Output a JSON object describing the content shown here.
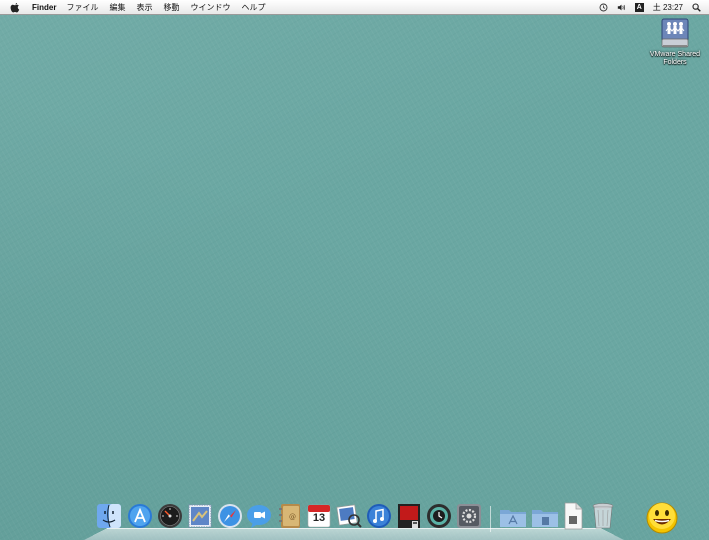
{
  "menubar": {
    "app_name": "Finder",
    "items": [
      "ファイル",
      "編集",
      "表示",
      "移動",
      "ウインドウ",
      "ヘルプ"
    ],
    "clock": "土 23:27",
    "input_badge": "A"
  },
  "desktop": {
    "icons": [
      {
        "label_line1": "VMware Shared",
        "label_line2": "Folders",
        "icon": "shared-folders-drive-icon"
      }
    ]
  },
  "dock": {
    "items": [
      {
        "name": "finder",
        "icon": "finder-icon"
      },
      {
        "name": "app-store",
        "icon": "app-store-icon"
      },
      {
        "name": "dashboard",
        "icon": "dashboard-icon"
      },
      {
        "name": "mail",
        "icon": "mail-stamp-icon"
      },
      {
        "name": "safari",
        "icon": "safari-compass-icon"
      },
      {
        "name": "ichat",
        "icon": "chat-bubble-icon"
      },
      {
        "name": "address-book",
        "icon": "address-book-icon"
      },
      {
        "name": "ical",
        "icon": "calendar-icon",
        "badge_text": "13"
      },
      {
        "name": "preview",
        "icon": "preview-icon"
      },
      {
        "name": "itunes",
        "icon": "itunes-icon"
      },
      {
        "name": "photo-booth",
        "icon": "photo-booth-icon"
      },
      {
        "name": "time-machine",
        "icon": "time-machine-icon"
      },
      {
        "name": "system-preferences",
        "icon": "system-preferences-icon"
      },
      {
        "name": "applications-stack",
        "icon": "applications-folder-icon"
      },
      {
        "name": "documents-stack",
        "icon": "documents-folder-icon"
      },
      {
        "name": "document",
        "icon": "document-icon"
      },
      {
        "name": "trash",
        "icon": "trash-icon"
      }
    ]
  },
  "colors": {
    "desktop": "#6aa7a2",
    "menubar": "#f2f2f2"
  }
}
